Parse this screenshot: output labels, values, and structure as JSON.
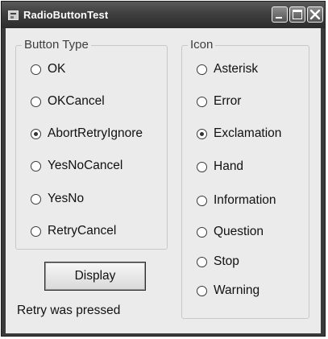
{
  "window": {
    "title": "RadioButtonTest",
    "app_icon": "app-form-icon",
    "caption_buttons": [
      "minimize",
      "maximize",
      "close"
    ]
  },
  "button_type_group": {
    "legend": "Button Type",
    "options": [
      {
        "label": "OK",
        "checked": false
      },
      {
        "label": "OKCancel",
        "checked": false
      },
      {
        "label": "AbortRetryIgnore",
        "checked": true
      },
      {
        "label": "YesNoCancel",
        "checked": false
      },
      {
        "label": "YesNo",
        "checked": false
      },
      {
        "label": "RetryCancel",
        "checked": false
      }
    ]
  },
  "icon_group": {
    "legend": "Icon",
    "options": [
      {
        "label": "Asterisk",
        "checked": false
      },
      {
        "label": "Error",
        "checked": false
      },
      {
        "label": "Exclamation",
        "checked": true
      },
      {
        "label": "Hand",
        "checked": false
      },
      {
        "label": "Information",
        "checked": false
      },
      {
        "label": "Question",
        "checked": false
      },
      {
        "label": "Stop",
        "checked": false
      },
      {
        "label": "Warning",
        "checked": false
      }
    ]
  },
  "display_button": {
    "label": "Display"
  },
  "status": {
    "text": "Retry was pressed"
  },
  "colors": {
    "title_bar": "#3f3f3f",
    "client": "#ebebeb"
  }
}
